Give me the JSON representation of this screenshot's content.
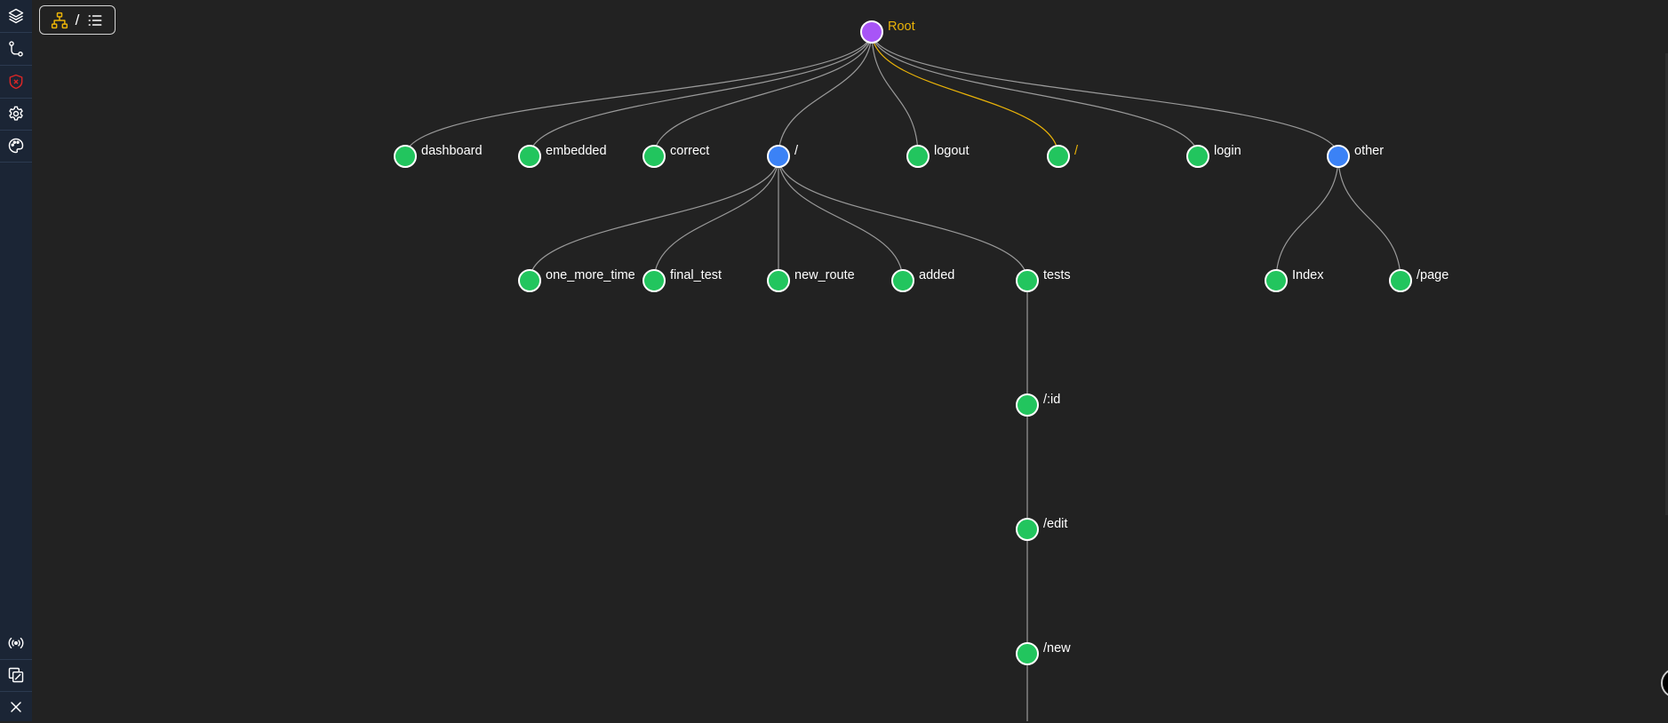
{
  "toolbar": {
    "separator": "/",
    "tree_view_icon": "sitemap-icon",
    "list_view_icon": "list-icon"
  },
  "sidebar": {
    "top_items": [
      {
        "name": "layers",
        "icon": "layers-icon"
      },
      {
        "name": "routes",
        "icon": "git-route-icon"
      },
      {
        "name": "shield",
        "icon": "shield-x-icon"
      },
      {
        "name": "settings",
        "icon": "gear-icon"
      },
      {
        "name": "theme",
        "icon": "palette-icon"
      }
    ],
    "bottom_items": [
      {
        "name": "broadcast",
        "icon": "broadcast-icon"
      },
      {
        "name": "window",
        "icon": "external-window-icon"
      },
      {
        "name": "close",
        "icon": "close-icon"
      }
    ]
  },
  "colors": {
    "background": "#222222",
    "sidebar": "#1b2535",
    "root_node": "#a855f7",
    "layout_node": "#3b82f6",
    "page_node": "#22c55e",
    "active": "#eab308",
    "edge": "#9a9a9a",
    "label": "#ffffff"
  },
  "tree": {
    "nodes": [
      {
        "id": "root",
        "label": "Root",
        "type": "root",
        "active": true
      },
      {
        "id": "dashboard",
        "label": "dashboard",
        "type": "page",
        "parent": "root"
      },
      {
        "id": "embedded",
        "label": "embedded",
        "type": "page",
        "parent": "root"
      },
      {
        "id": "correct",
        "label": "correct",
        "type": "page",
        "parent": "root"
      },
      {
        "id": "slash-layout",
        "label": "/",
        "type": "layout",
        "parent": "root"
      },
      {
        "id": "logout",
        "label": "logout",
        "type": "page",
        "parent": "root"
      },
      {
        "id": "slash-page",
        "label": "/",
        "type": "page",
        "parent": "root",
        "active": true
      },
      {
        "id": "login",
        "label": "login",
        "type": "page",
        "parent": "root"
      },
      {
        "id": "other",
        "label": "other",
        "type": "layout",
        "parent": "root"
      },
      {
        "id": "one_more_time",
        "label": "one_more_time",
        "type": "page",
        "parent": "slash-layout"
      },
      {
        "id": "final_test",
        "label": "final_test",
        "type": "page",
        "parent": "slash-layout"
      },
      {
        "id": "new_route",
        "label": "new_route",
        "type": "page",
        "parent": "slash-layout"
      },
      {
        "id": "added",
        "label": "added",
        "type": "page",
        "parent": "slash-layout"
      },
      {
        "id": "tests",
        "label": "tests",
        "type": "page",
        "parent": "slash-layout"
      },
      {
        "id": "index",
        "label": "Index",
        "type": "page",
        "parent": "other"
      },
      {
        "id": "page",
        "label": "/page",
        "type": "page",
        "parent": "other"
      },
      {
        "id": "id",
        "label": "/:id",
        "type": "page",
        "parent": "tests"
      },
      {
        "id": "edit",
        "label": "/edit",
        "type": "page",
        "parent": "id"
      },
      {
        "id": "new",
        "label": "/new",
        "type": "page",
        "parent": "edit"
      }
    ]
  }
}
